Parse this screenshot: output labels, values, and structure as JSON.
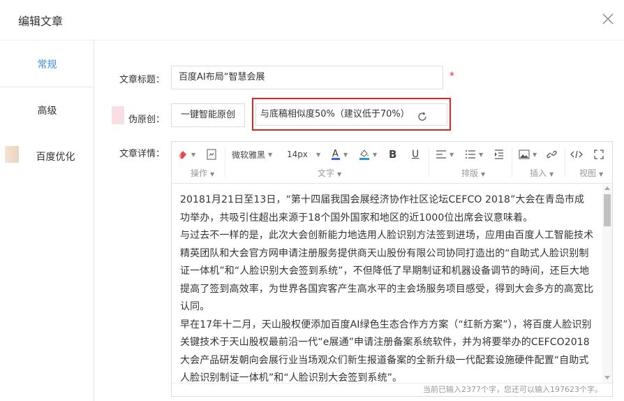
{
  "dialog": {
    "title": "编辑文章"
  },
  "sidebar": {
    "items": [
      {
        "label": "常规",
        "active": true
      },
      {
        "label": "高级",
        "active": false
      },
      {
        "label": "百度优化",
        "active": false
      }
    ]
  },
  "form": {
    "title_label": "文章标题：",
    "title_value": "百度AI布局“智慧会展",
    "required_mark": "*",
    "original_label": "伪原创：",
    "original_button": "一键智能原创",
    "similarity_text": "与底稿相似度50%（建议低于70%）",
    "detail_label": "文章详情："
  },
  "toolbar": {
    "font_family": "微软雅黑",
    "font_size": "14px",
    "groups": [
      "操作",
      "文字",
      "排版",
      "插入",
      "视图"
    ]
  },
  "editor": {
    "paragraphs": [
      "20181月21日至13日，“第十四届我国会展经济协作社区论坛CEFCO 2018”大会在青岛市成功举办，共吸引住超出来源于18个国外国家和地区的近1000位出席会议意味着。",
      "与过去不一样的是，此次大会创新能力地选用人脸识别方法签到进场，应用由百度人工智能技术精英团队和大会官方网申请注册服务提供商天山股份有限公司协同打造出的“自助式人脸识别制证一体机”和“人脸识别大会签到系统”，不但降低了早期制证和机器设备调节的時间，还巨大地提高了签到高效率，为世界各国宾客产生高水平的主会场服务项目感受，得到大会多方的高宽比认同。",
      "早在17年十二月，天山股权便添加百度AI绿色生态合作方方案（“红新方案”），将百度人脸识别关键技术于天山股权最前沿一代“e展通”申请注册备案系统软件，并为将要举办的CEFCO2018大会产品研发朝向会展行业当场观众们新生报道备案的全新升级一代配套设施硬件配置“自助式人脸识别制证一体机”和“人脸识别大会签到系统”。"
    ],
    "status": "当前已输入2377个字，您还可以输入197623个字。"
  },
  "colors": {
    "accent": "#3a8ee6",
    "highlight_border": "#e02424",
    "required": "#f23030"
  }
}
